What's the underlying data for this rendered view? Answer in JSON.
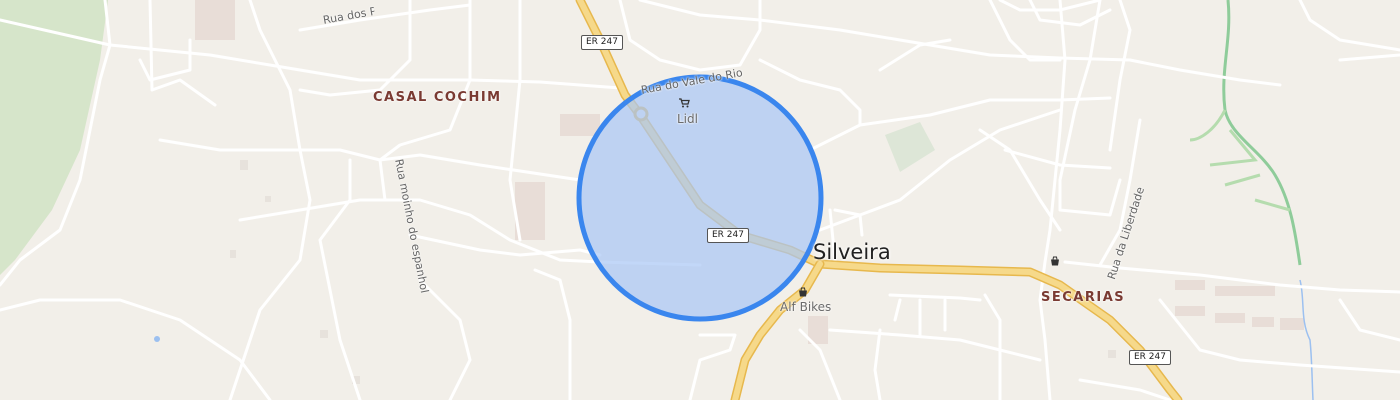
{
  "map": {
    "place_labels": {
      "casal_cochim": "CASAL COCHIM",
      "secarias": "SECARIAS"
    },
    "town_label": "Silveira",
    "road_shields": [
      "ER 247",
      "ER 247",
      "ER 247"
    ],
    "street_labels": {
      "rua_dos": "Rua dos P",
      "vale_do_rio": "Rua do Vale do Rio",
      "moinho": "Rua moinho do espanhol",
      "liberdade": "Rua da Liberdade"
    },
    "pois": {
      "lidl": "Lidl",
      "alf_bikes": "Alf Bikes"
    },
    "icons": {
      "supermarket": "shopping-cart-icon",
      "shop": "shopping-bag-icon",
      "roundabout": "roundabout-icon"
    },
    "colors": {
      "background": "#f2efe9",
      "highway": "#f6d98a",
      "highway_casing": "#e7b84d",
      "road": "#ffffff",
      "forest": "#d4e4c8",
      "stream": "#8fcc9a",
      "circle_fill": "#a8c6f5",
      "circle_stroke": "#3a86ee"
    }
  }
}
